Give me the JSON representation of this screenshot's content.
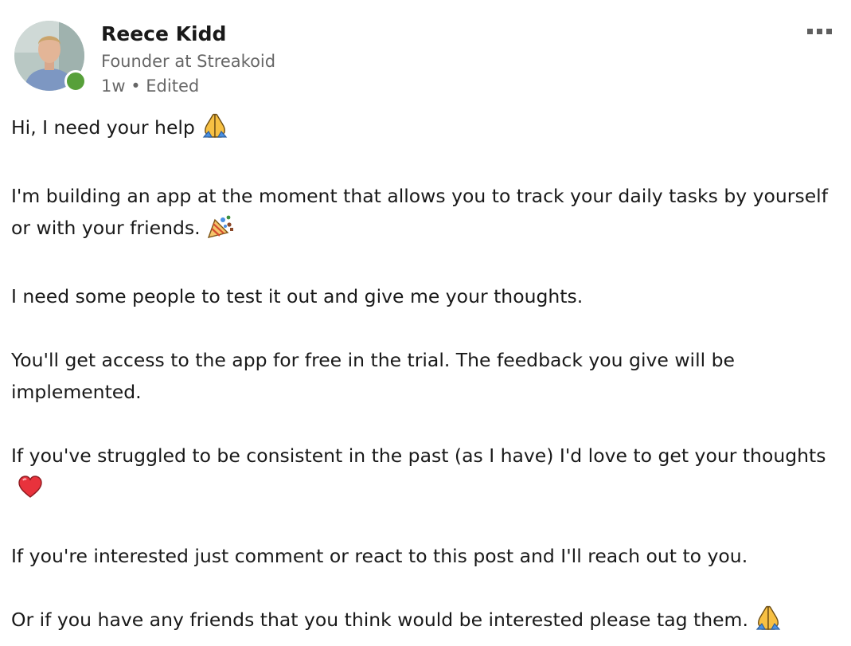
{
  "author": {
    "name": "Reece Kidd",
    "headline": "Founder at Streakoid",
    "meta": "1w • Edited",
    "presence": "online",
    "presence_color": "#57a03a"
  },
  "menu": {
    "icon": "more-horizontal-icon"
  },
  "post": {
    "p1": "Hi, I need your help",
    "p1_emoji": "folded-hands-icon",
    "p2": " I'm building an app at the moment that allows you to track your daily tasks by yourself or with your friends.",
    "p2_emoji": "party-popper-icon",
    "p3": "I need some people to test it out and give me your thoughts.",
    "p4": "You'll get access to the app for free in the trial. The feedback you give will be implemented.",
    "p5": "If you've struggled to be consistent in the past (as I have) I'd love to get your thoughts",
    "p5_emoji": "red-heart-icon",
    "p6": "If you're interested just comment or react to this post and I'll reach out to you.",
    "p7": "Or if you have any friends that you think would be interested please tag them.",
    "p7_emoji": "folded-hands-icon"
  }
}
